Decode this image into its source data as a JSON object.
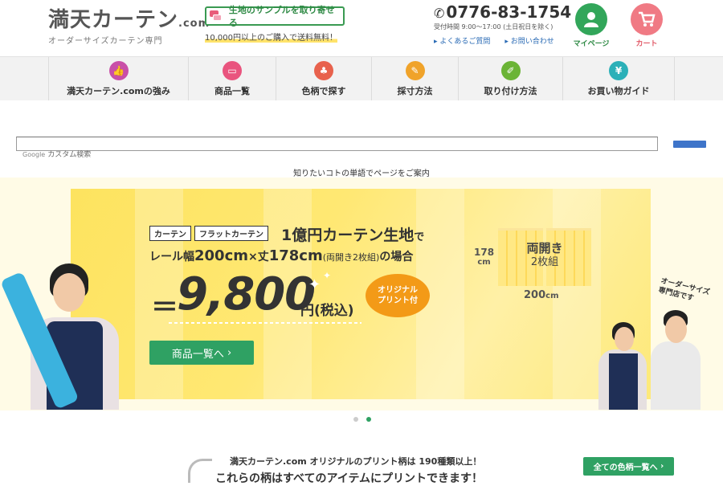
{
  "header": {
    "logo_main": "満天カーテン",
    "logo_com": ".com",
    "logo_sub": "オーダーサイズカーテン専門",
    "sample_button": "生地のサンプルを取り寄せる",
    "shipping_note": "10,000円以上のご購入で送料無料！",
    "phone": "0776-83-1754",
    "hours": "受付時間 9:00〜17:00 (土日祝日を除く)",
    "faq_link": "よくあるご質問",
    "contact_link": "お問い合わせ",
    "mypage_label": "マイページ",
    "cart_label": "カート"
  },
  "nav": {
    "items": [
      {
        "label": "満天カーテン.comの強み",
        "icon": "thumbs-up-icon",
        "color": "#c94fa8"
      },
      {
        "label": "商品一覧",
        "icon": "list-icon",
        "color": "#e9547e"
      },
      {
        "label": "色柄で探す",
        "icon": "clover-icon",
        "color": "#e8624d"
      },
      {
        "label": "採寸方法",
        "icon": "pencil-icon",
        "color": "#f0a32a"
      },
      {
        "label": "取り付け方法",
        "icon": "brush-icon",
        "color": "#6bb436"
      },
      {
        "label": "お買い物ガイド",
        "icon": "yen-icon",
        "color": "#2bb0b8"
      }
    ]
  },
  "search": {
    "google_label": "Google",
    "placeholder": "カスタム検索",
    "help_text": "知りたいコトの単語でページをご案内"
  },
  "banner": {
    "tag1": "カーテン",
    "tag2": "フラットカーテン",
    "headline": "1億円カーテン生地",
    "headline_suffix": "で",
    "size_prefix": "レール幅",
    "width_value": "200cm",
    "times": "×",
    "height_prefix": "丈",
    "height_value": "178cm",
    "size_note": "(両開き2枚組)",
    "size_suffix": "の場合",
    "price_eq": "＝",
    "price": "9,800",
    "price_suffix": "円(税込)",
    "bubble_line1": "オリジナル",
    "bubble_line2": "プリント付",
    "list_button": "商品一覧へ",
    "curtain_line1": "両開き",
    "curtain_line2": "2枚組",
    "dim_height": "178",
    "dim_height_unit": "cm",
    "dim_width": "200",
    "dim_width_unit": "cm",
    "shop_caption_1": "オーダーサイズ",
    "shop_caption_2": "専門店です"
  },
  "carousel": {
    "total": 2,
    "active": 2
  },
  "bottom": {
    "title": "満天カーテン.com オリジナルのプリント柄は 190種類以上！",
    "subtitle": "これらの柄はすべてのアイテムにプリントできます！",
    "all_button": "全ての色柄一覧へ"
  }
}
